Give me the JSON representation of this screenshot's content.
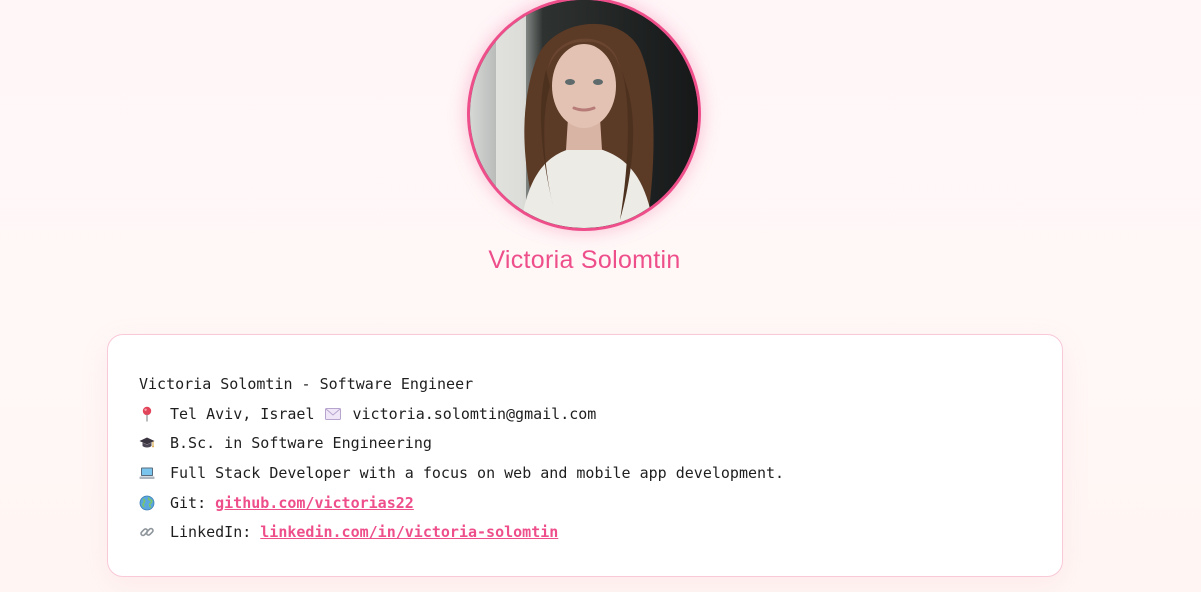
{
  "profile": {
    "name": "Victoria Solomtin",
    "avatar_alt": "Profile photo"
  },
  "card": {
    "headline": "Victoria Solomtin - Software Engineer",
    "location": "Tel Aviv, Israel",
    "email": "victoria.solomtin@gmail.com",
    "education": "B.Sc. in Software Engineering",
    "role": "Full Stack Developer with a focus on web and mobile app development.",
    "git_label": "Git:",
    "git_link": "github.com/victorias22",
    "linkedin_label": "LinkedIn:",
    "linkedin_link": "linkedin.com/in/victoria-solomtin"
  },
  "icons": {
    "location": "pin-icon",
    "email": "envelope-icon",
    "education": "graduation-cap-icon",
    "role": "laptop-icon",
    "git": "globe-icon",
    "linkedin": "link-icon"
  },
  "colors": {
    "accent": "#ee4f8b",
    "card_border": "#f9c9d8",
    "text": "#1f1f1f"
  }
}
